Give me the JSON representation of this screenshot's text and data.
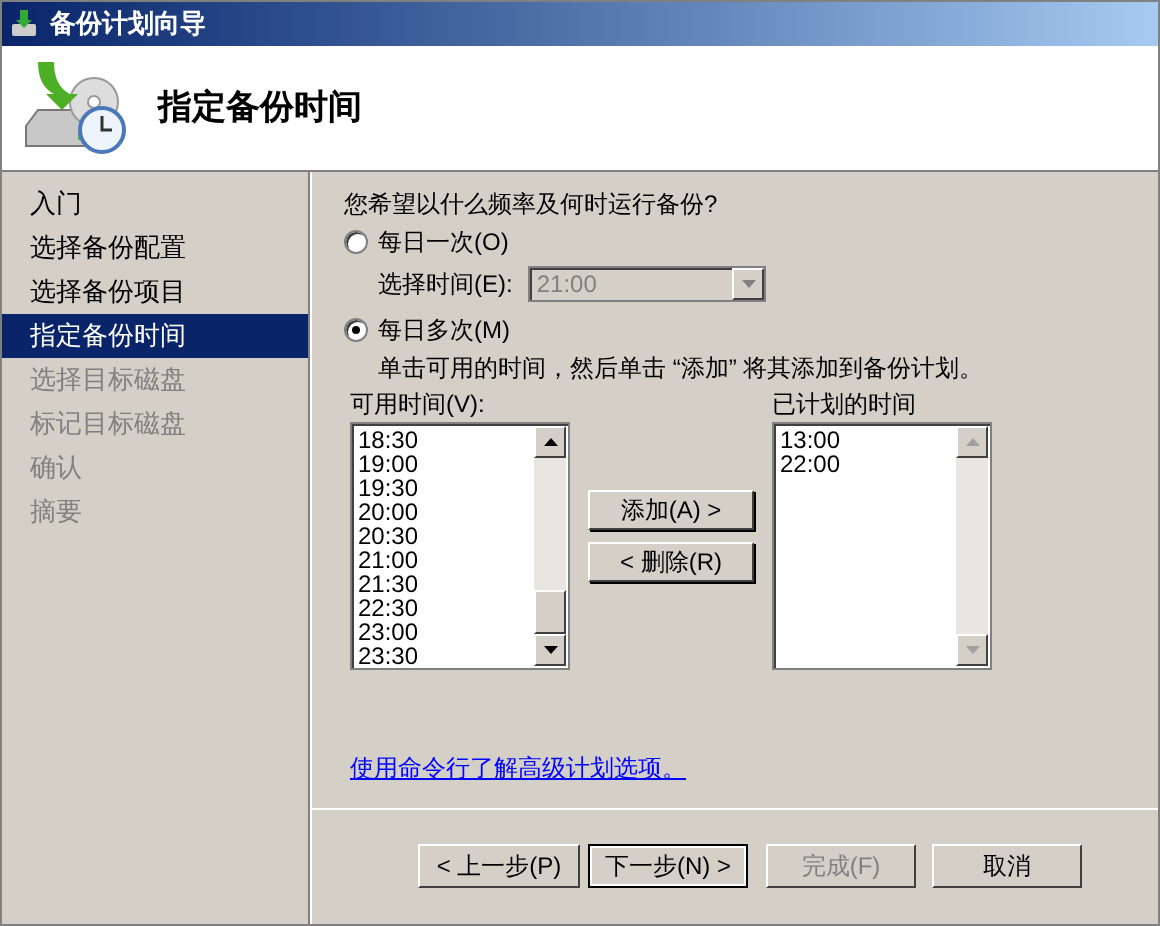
{
  "window": {
    "title": "备份计划向导"
  },
  "header": {
    "title": "指定备份时间"
  },
  "sidebar": {
    "items": [
      {
        "label": "入门",
        "selected": false,
        "disabled": false
      },
      {
        "label": "选择备份配置",
        "selected": false,
        "disabled": false
      },
      {
        "label": "选择备份项目",
        "selected": false,
        "disabled": false
      },
      {
        "label": "指定备份时间",
        "selected": true,
        "disabled": false
      },
      {
        "label": "选择目标磁盘",
        "selected": false,
        "disabled": true
      },
      {
        "label": "标记目标磁盘",
        "selected": false,
        "disabled": true
      },
      {
        "label": "确认",
        "selected": false,
        "disabled": true
      },
      {
        "label": "摘要",
        "selected": false,
        "disabled": true
      }
    ]
  },
  "content": {
    "question": "您希望以什么频率及何时运行备份?",
    "once": {
      "label": "每日一次(O)",
      "selected": false,
      "time_label": "选择时间(E):",
      "time_value": "21:00",
      "time_disabled": true
    },
    "multiple": {
      "label": "每日多次(M)",
      "selected": true,
      "instruction": "单击可用的时间，然后单击 “添加” 将其添加到备份计划。"
    },
    "available": {
      "label": "可用时间(V):",
      "items": [
        "18:30",
        "19:00",
        "19:30",
        "20:00",
        "20:30",
        "21:00",
        "21:30",
        "22:30",
        "23:00",
        "23:30"
      ]
    },
    "add_button": "添加(A) >",
    "remove_button": "< 删除(R)",
    "scheduled": {
      "label": "已计划的时间",
      "items": [
        "13:00",
        "22:00"
      ]
    },
    "link": "使用命令行了解高级计划选项。"
  },
  "buttons": [
    {
      "label": "< 上一步(P)",
      "disabled": false,
      "default": false
    },
    {
      "label": "下一步(N) >",
      "disabled": false,
      "default": true
    },
    {
      "label": "完成(F)",
      "disabled": true,
      "default": false
    },
    {
      "label": "取消",
      "disabled": false,
      "default": false
    }
  ]
}
